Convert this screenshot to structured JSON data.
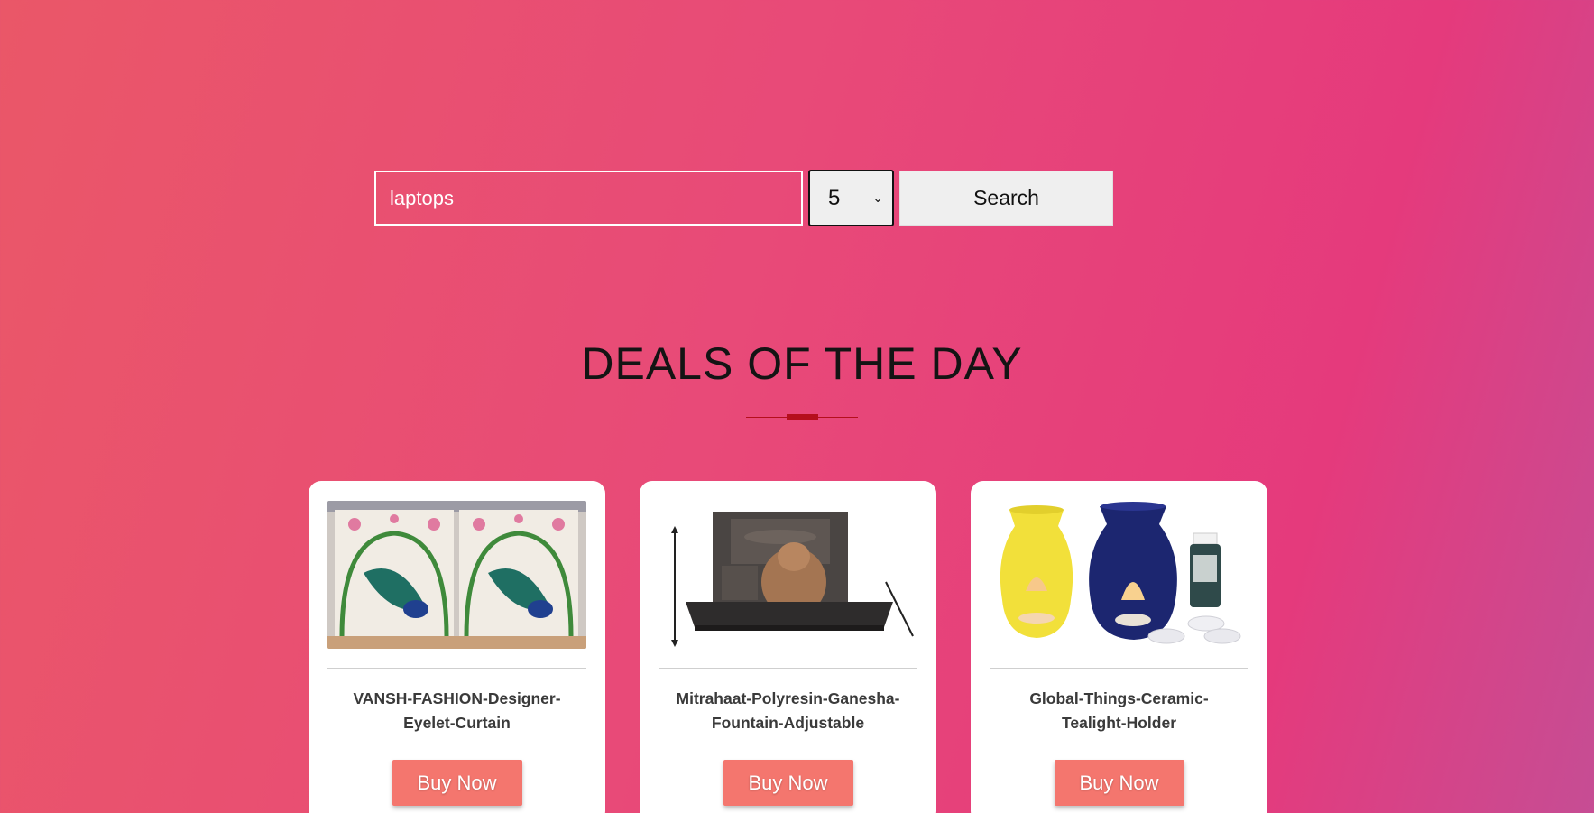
{
  "search": {
    "value": "laptops",
    "count_selected": "5",
    "button_label": "Search"
  },
  "section": {
    "title": "DEALS OF THE DAY"
  },
  "products": [
    {
      "title_line1": "VANSH-FASHION-Designer-",
      "title_line2": "Eyelet-Curtain",
      "button_label": "Buy Now",
      "image": "peacock-curtain-image"
    },
    {
      "title_line1": "Mitrahaat-Polyresin-Ganesha-",
      "title_line2": "Fountain-Adjustable",
      "button_label": "Buy Now",
      "image": "ganesha-fountain-image"
    },
    {
      "title_line1": "Global-Things-Ceramic-",
      "title_line2": "Tealight-Holder",
      "button_label": "Buy Now",
      "image": "ceramic-tealight-holder-image"
    }
  ],
  "colors": {
    "background_start": "#ea5768",
    "background_end": "#c64d94",
    "buy_button": "#f4766e",
    "divider": "#b50f1c"
  }
}
